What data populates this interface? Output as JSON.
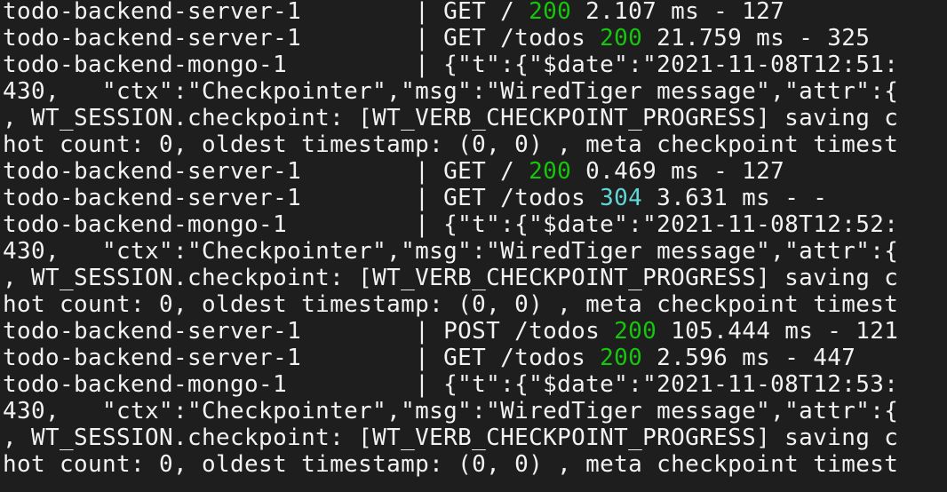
{
  "colors": {
    "background": "#1e1e1e",
    "text": "#f2f2f2",
    "status_ok": "#16c60c",
    "status_not_modified": "#61d6d6"
  },
  "lines": [
    [
      {
        "text": "todo-backend-server-1        | GET / ",
        "color": "#f2f2f2"
      },
      {
        "text": "200",
        "color": "#16c60c"
      },
      {
        "text": " 2.107 ms - 127",
        "color": "#f2f2f2"
      }
    ],
    [
      {
        "text": "todo-backend-server-1        | GET /todos ",
        "color": "#f2f2f2"
      },
      {
        "text": "200",
        "color": "#16c60c"
      },
      {
        "text": " 21.759 ms - 325",
        "color": "#f2f2f2"
      }
    ],
    [
      {
        "text": "todo-backend-mongo-1         | {\"t\":{\"$date\":\"2021-11-08T12:51:",
        "color": "#f2f2f2"
      }
    ],
    [
      {
        "text": "430,   \"ctx\":\"Checkpointer\",\"msg\":\"WiredTiger message\",\"attr\":{",
        "color": "#f2f2f2"
      }
    ],
    [
      {
        "text": ", WT_SESSION.checkpoint: [WT_VERB_CHECKPOINT_PROGRESS] saving c",
        "color": "#f2f2f2"
      }
    ],
    [
      {
        "text": "hot count: 0, oldest timestamp: (0, 0) , meta checkpoint timest",
        "color": "#f2f2f2"
      }
    ],
    [
      {
        "text": "todo-backend-server-1        | GET / ",
        "color": "#f2f2f2"
      },
      {
        "text": "200",
        "color": "#16c60c"
      },
      {
        "text": " 0.469 ms - 127",
        "color": "#f2f2f2"
      }
    ],
    [
      {
        "text": "todo-backend-server-1        | GET /todos ",
        "color": "#f2f2f2"
      },
      {
        "text": "304",
        "color": "#61d6d6"
      },
      {
        "text": " 3.631 ms - -",
        "color": "#f2f2f2"
      }
    ],
    [
      {
        "text": "todo-backend-mongo-1         | {\"t\":{\"$date\":\"2021-11-08T12:52:",
        "color": "#f2f2f2"
      }
    ],
    [
      {
        "text": "430,   \"ctx\":\"Checkpointer\",\"msg\":\"WiredTiger message\",\"attr\":{",
        "color": "#f2f2f2"
      }
    ],
    [
      {
        "text": ", WT_SESSION.checkpoint: [WT_VERB_CHECKPOINT_PROGRESS] saving c",
        "color": "#f2f2f2"
      }
    ],
    [
      {
        "text": "hot count: 0, oldest timestamp: (0, 0) , meta checkpoint timest",
        "color": "#f2f2f2"
      }
    ],
    [
      {
        "text": "todo-backend-server-1        | POST /todos ",
        "color": "#f2f2f2"
      },
      {
        "text": "200",
        "color": "#16c60c"
      },
      {
        "text": " 105.444 ms - 121",
        "color": "#f2f2f2"
      }
    ],
    [
      {
        "text": "todo-backend-server-1        | GET /todos ",
        "color": "#f2f2f2"
      },
      {
        "text": "200",
        "color": "#16c60c"
      },
      {
        "text": " 2.596 ms - 447",
        "color": "#f2f2f2"
      }
    ],
    [
      {
        "text": "todo-backend-mongo-1         | {\"t\":{\"$date\":\"2021-11-08T12:53:",
        "color": "#f2f2f2"
      }
    ],
    [
      {
        "text": "430,   \"ctx\":\"Checkpointer\",\"msg\":\"WiredTiger message\",\"attr\":{",
        "color": "#f2f2f2"
      }
    ],
    [
      {
        "text": ", WT_SESSION.checkpoint: [WT_VERB_CHECKPOINT_PROGRESS] saving c",
        "color": "#f2f2f2"
      }
    ],
    [
      {
        "text": "hot count: 0, oldest timestamp: (0, 0) , meta checkpoint timest",
        "color": "#f2f2f2"
      }
    ]
  ]
}
